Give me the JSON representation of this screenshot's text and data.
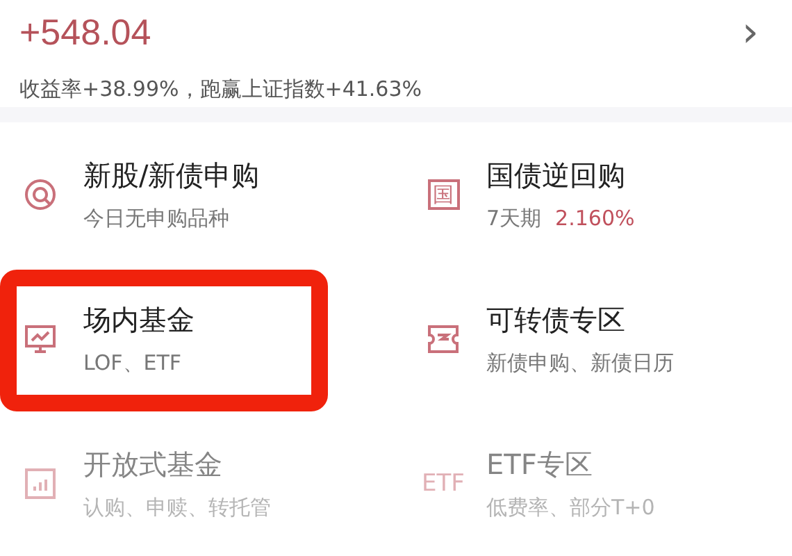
{
  "summary": {
    "amount": "+548.04",
    "arrow": "›",
    "detail": "收益率+38.99%，跑赢上证指数+41.63%"
  },
  "items": [
    {
      "kind": "target",
      "title": "新股/新债申购",
      "subtitle": "今日无申购品种",
      "highlighted": false,
      "dimmed": false
    },
    {
      "kind": "glyph",
      "icon_text": "国",
      "title": "国债逆回购",
      "subtitle": "7天期",
      "rate": "2.160%",
      "highlighted": false,
      "dimmed": false
    },
    {
      "kind": "monitor",
      "title": "场内基金",
      "subtitle": "LOF、ETF",
      "highlighted": true,
      "dimmed": false
    },
    {
      "kind": "ticket",
      "title": "可转债专区",
      "subtitle": "新债申购、新债日历",
      "highlighted": false,
      "dimmed": false
    },
    {
      "kind": "bars",
      "title": "开放式基金",
      "subtitle": "认购、申赎、转托管",
      "highlighted": false,
      "dimmed": true
    },
    {
      "kind": "glyph",
      "icon_text": "ETF",
      "title": "ETF专区",
      "subtitle": "低费率、部分T+0",
      "highlighted": false,
      "dimmed": true
    }
  ]
}
